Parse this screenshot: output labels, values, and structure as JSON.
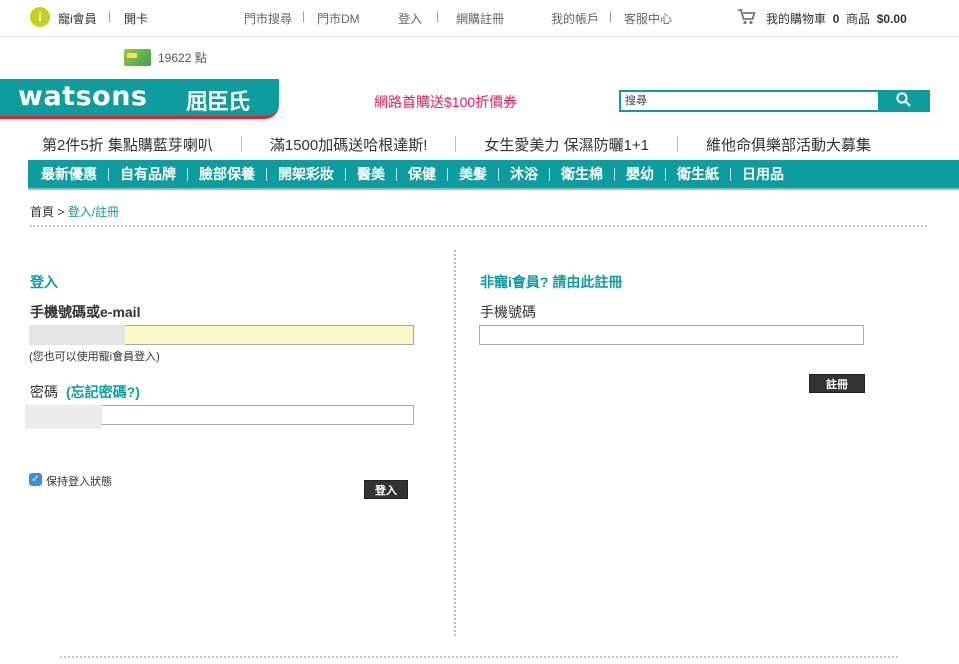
{
  "topbar": {
    "member_icon_glyph": "i",
    "member_label": "寵i會員",
    "open_card": "開卡",
    "store_search": "門市搜尋",
    "store_dm": "門市DM",
    "login": "登入",
    "register": "網購註冊",
    "my_account": "我的帳戶",
    "customer_service": "客服中心",
    "cart_label": "我的購物車",
    "cart_count": "0",
    "cart_items_label": "商品",
    "cart_amount": "$0.00",
    "separator": "|"
  },
  "points": {
    "value": "19622 點"
  },
  "logo": {
    "text": "watsons",
    "chinese": "屈臣氏"
  },
  "promo": "網路首購送$100折價券",
  "search": {
    "placeholder": "搜尋",
    "button_icon": "magnifier-icon"
  },
  "banners": [
    "第2件5折 集點購藍芽喇叭",
    "滿1500加碼送哈根達斯!",
    "女生愛美力 保濕防曬1+1",
    "維他命俱樂部活動大募集"
  ],
  "nav": [
    "最新優惠",
    "自有品牌",
    "臉部保養",
    "開架彩妝",
    "醫美",
    "保健",
    "美髮",
    "沐浴",
    "衛生棉",
    "嬰幼",
    "衛生紙",
    "日用品"
  ],
  "breadcrumb": {
    "home": "首頁",
    "separator": ">",
    "current": "登入/註冊"
  },
  "login": {
    "title": "登入",
    "account_label": "手機號碼或e-mail",
    "account_value": "",
    "note": "(您也可以使用寵i會員登入)",
    "password_label": "密碼",
    "forgot_link": "(忘記密碼?)",
    "password_value": "",
    "remember_checked": true,
    "remember_label": "保持登入狀態",
    "submit": "登入"
  },
  "signup": {
    "title": "非寵i會員? 請由此註冊",
    "phone_label": "手機號碼",
    "phone_value": "",
    "submit": "註冊"
  },
  "colors": {
    "brand_teal": "#0d9d9e",
    "brand_red": "#e0213b",
    "promo_pink": "#e4215f",
    "member_green": "#c2d21d",
    "autofill_yellow": "#fafac8"
  }
}
